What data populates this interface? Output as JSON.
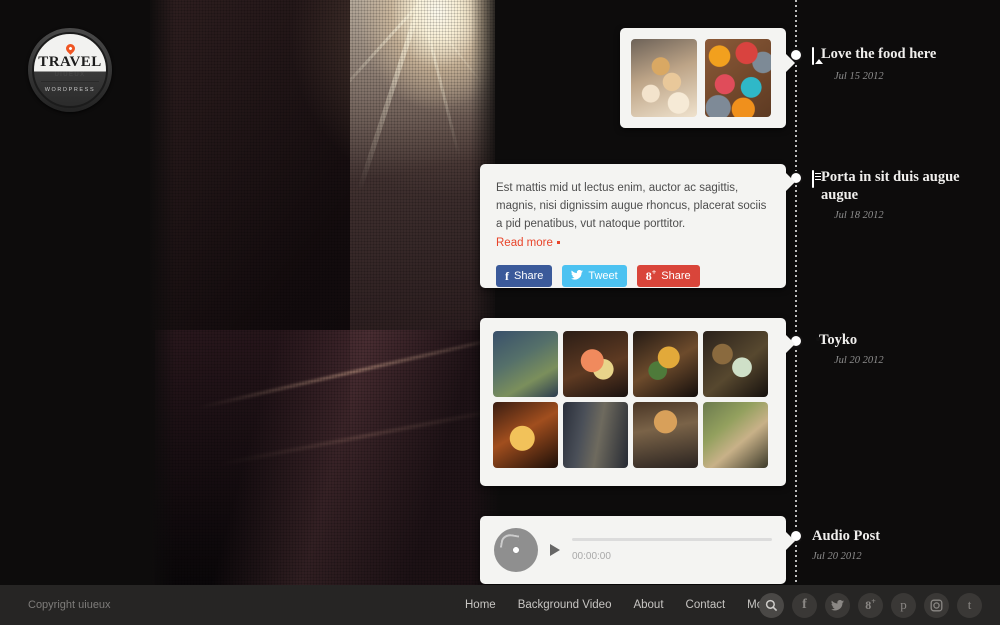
{
  "site": {
    "logo": {
      "title": "TRAVEL",
      "subtitle": "UIUEUX",
      "footer": "WORDPRESS",
      "pin_icon": "location-pin-icon",
      "accent": "#ef5523"
    },
    "background": {
      "description": "dark city street at dusk with sun flare",
      "halftone_overlay": true
    }
  },
  "timeline": {
    "entries": [
      {
        "title": "Love the food here",
        "date": "Jul 15 2012",
        "icon": "image-icon",
        "type": "gallery"
      },
      {
        "title": "Porta in sit duis augue augue",
        "date": "Jul 18 2012",
        "icon": "document-icon",
        "type": "text"
      },
      {
        "title": "Toyko",
        "date": "Jul 20 2012",
        "icon": "map-pin-icon",
        "type": "gallery"
      },
      {
        "title": "Audio Post",
        "date": "Jul 20 2012",
        "icon": "",
        "type": "audio"
      }
    ]
  },
  "cards": {
    "photos": {
      "items": [
        {
          "alt": "cream puff pastries"
        },
        {
          "alt": "colorful frosted cupcakes"
        }
      ]
    },
    "text": {
      "body": "Est mattis mid ut lectus enim, auctor ac sagittis, magnis, nisi dignissim augue rhoncus, placerat sociis a pid penatibus, vut natoque porttitor.",
      "read_more": "Read more",
      "share": [
        {
          "label": "Share",
          "icon": "facebook-icon",
          "color": "#3b5a9a"
        },
        {
          "label": "Tweet",
          "icon": "twitter-icon",
          "color": "#4cc2f1"
        },
        {
          "label": "Share",
          "icon": "google-plus-icon",
          "color": "#d9453a"
        }
      ]
    },
    "gallery": {
      "items": [
        {
          "alt": "wrapped bamboo leaf dish"
        },
        {
          "alt": "sashimi rice bowl"
        },
        {
          "alt": "hot stone bibimbap"
        },
        {
          "alt": "japanese bento platter"
        },
        {
          "alt": "lit street signage at night"
        },
        {
          "alt": "tokyo city buildings"
        },
        {
          "alt": "busy shopping street"
        },
        {
          "alt": "sushi on banana leaf"
        }
      ]
    },
    "audio": {
      "record_icon": "vinyl-record-icon",
      "play_icon": "play-icon",
      "time": "00:00:00",
      "progress_percent": 0
    }
  },
  "footer": {
    "copyright": "Copyright uiueux",
    "nav": [
      {
        "label": "Home"
      },
      {
        "label": "Background Video"
      },
      {
        "label": "About"
      },
      {
        "label": "Contact"
      },
      {
        "label": "More",
        "has_dot": true
      }
    ],
    "socials": [
      {
        "name": "search-icon",
        "glyph": ""
      },
      {
        "name": "facebook-icon",
        "glyph": "f"
      },
      {
        "name": "twitter-icon",
        "glyph": ""
      },
      {
        "name": "google-plus-icon",
        "glyph": ""
      },
      {
        "name": "pinterest-icon",
        "glyph": ""
      },
      {
        "name": "instagram-icon",
        "glyph": ""
      },
      {
        "name": "tumblr-icon",
        "glyph": "t"
      }
    ]
  }
}
